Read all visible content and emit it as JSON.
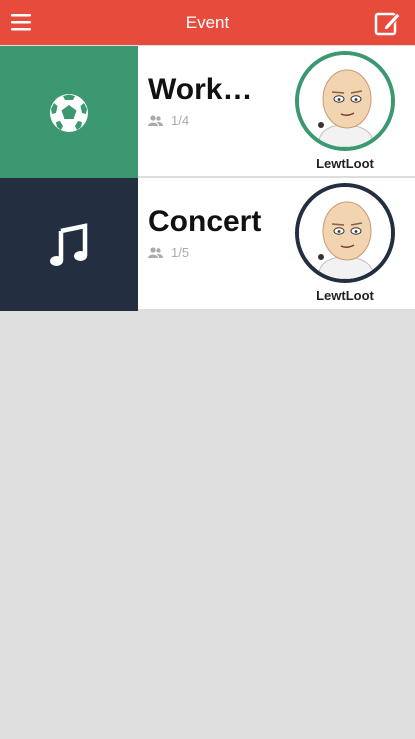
{
  "header": {
    "title": "Event",
    "background": "#e64b3c",
    "menu_icon": "hamburger-menu-icon",
    "edit_icon": "compose-icon"
  },
  "events": [
    {
      "title": "Work…",
      "participants": "1/4",
      "host": "LewtLoot",
      "category_icon": "soccer-ball-icon",
      "tile_color": "#3b9870",
      "ring_color": "#3b9870"
    },
    {
      "title": "Concert",
      "participants": "1/5",
      "host": "LewtLoot",
      "category_icon": "music-note-icon",
      "tile_color": "#232f40",
      "ring_color": "#232f40"
    }
  ]
}
